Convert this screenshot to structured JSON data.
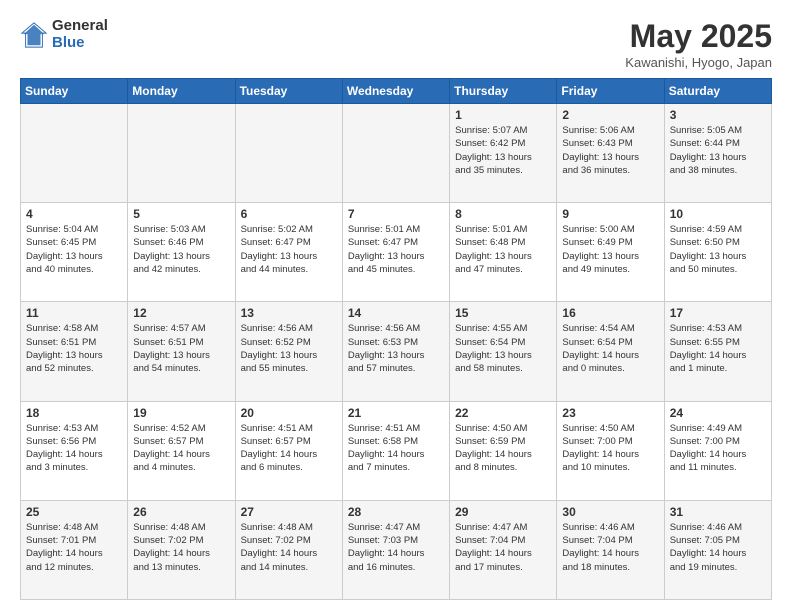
{
  "logo": {
    "general": "General",
    "blue": "Blue"
  },
  "header": {
    "title": "May 2025",
    "subtitle": "Kawanishi, Hyogo, Japan"
  },
  "weekdays": [
    "Sunday",
    "Monday",
    "Tuesday",
    "Wednesday",
    "Thursday",
    "Friday",
    "Saturday"
  ],
  "weeks": [
    [
      {
        "day": "",
        "info": ""
      },
      {
        "day": "",
        "info": ""
      },
      {
        "day": "",
        "info": ""
      },
      {
        "day": "",
        "info": ""
      },
      {
        "day": "1",
        "info": "Sunrise: 5:07 AM\nSunset: 6:42 PM\nDaylight: 13 hours\nand 35 minutes."
      },
      {
        "day": "2",
        "info": "Sunrise: 5:06 AM\nSunset: 6:43 PM\nDaylight: 13 hours\nand 36 minutes."
      },
      {
        "day": "3",
        "info": "Sunrise: 5:05 AM\nSunset: 6:44 PM\nDaylight: 13 hours\nand 38 minutes."
      }
    ],
    [
      {
        "day": "4",
        "info": "Sunrise: 5:04 AM\nSunset: 6:45 PM\nDaylight: 13 hours\nand 40 minutes."
      },
      {
        "day": "5",
        "info": "Sunrise: 5:03 AM\nSunset: 6:46 PM\nDaylight: 13 hours\nand 42 minutes."
      },
      {
        "day": "6",
        "info": "Sunrise: 5:02 AM\nSunset: 6:47 PM\nDaylight: 13 hours\nand 44 minutes."
      },
      {
        "day": "7",
        "info": "Sunrise: 5:01 AM\nSunset: 6:47 PM\nDaylight: 13 hours\nand 45 minutes."
      },
      {
        "day": "8",
        "info": "Sunrise: 5:01 AM\nSunset: 6:48 PM\nDaylight: 13 hours\nand 47 minutes."
      },
      {
        "day": "9",
        "info": "Sunrise: 5:00 AM\nSunset: 6:49 PM\nDaylight: 13 hours\nand 49 minutes."
      },
      {
        "day": "10",
        "info": "Sunrise: 4:59 AM\nSunset: 6:50 PM\nDaylight: 13 hours\nand 50 minutes."
      }
    ],
    [
      {
        "day": "11",
        "info": "Sunrise: 4:58 AM\nSunset: 6:51 PM\nDaylight: 13 hours\nand 52 minutes."
      },
      {
        "day": "12",
        "info": "Sunrise: 4:57 AM\nSunset: 6:51 PM\nDaylight: 13 hours\nand 54 minutes."
      },
      {
        "day": "13",
        "info": "Sunrise: 4:56 AM\nSunset: 6:52 PM\nDaylight: 13 hours\nand 55 minutes."
      },
      {
        "day": "14",
        "info": "Sunrise: 4:56 AM\nSunset: 6:53 PM\nDaylight: 13 hours\nand 57 minutes."
      },
      {
        "day": "15",
        "info": "Sunrise: 4:55 AM\nSunset: 6:54 PM\nDaylight: 13 hours\nand 58 minutes."
      },
      {
        "day": "16",
        "info": "Sunrise: 4:54 AM\nSunset: 6:54 PM\nDaylight: 14 hours\nand 0 minutes."
      },
      {
        "day": "17",
        "info": "Sunrise: 4:53 AM\nSunset: 6:55 PM\nDaylight: 14 hours\nand 1 minute."
      }
    ],
    [
      {
        "day": "18",
        "info": "Sunrise: 4:53 AM\nSunset: 6:56 PM\nDaylight: 14 hours\nand 3 minutes."
      },
      {
        "day": "19",
        "info": "Sunrise: 4:52 AM\nSunset: 6:57 PM\nDaylight: 14 hours\nand 4 minutes."
      },
      {
        "day": "20",
        "info": "Sunrise: 4:51 AM\nSunset: 6:57 PM\nDaylight: 14 hours\nand 6 minutes."
      },
      {
        "day": "21",
        "info": "Sunrise: 4:51 AM\nSunset: 6:58 PM\nDaylight: 14 hours\nand 7 minutes."
      },
      {
        "day": "22",
        "info": "Sunrise: 4:50 AM\nSunset: 6:59 PM\nDaylight: 14 hours\nand 8 minutes."
      },
      {
        "day": "23",
        "info": "Sunrise: 4:50 AM\nSunset: 7:00 PM\nDaylight: 14 hours\nand 10 minutes."
      },
      {
        "day": "24",
        "info": "Sunrise: 4:49 AM\nSunset: 7:00 PM\nDaylight: 14 hours\nand 11 minutes."
      }
    ],
    [
      {
        "day": "25",
        "info": "Sunrise: 4:48 AM\nSunset: 7:01 PM\nDaylight: 14 hours\nand 12 minutes."
      },
      {
        "day": "26",
        "info": "Sunrise: 4:48 AM\nSunset: 7:02 PM\nDaylight: 14 hours\nand 13 minutes."
      },
      {
        "day": "27",
        "info": "Sunrise: 4:48 AM\nSunset: 7:02 PM\nDaylight: 14 hours\nand 14 minutes."
      },
      {
        "day": "28",
        "info": "Sunrise: 4:47 AM\nSunset: 7:03 PM\nDaylight: 14 hours\nand 16 minutes."
      },
      {
        "day": "29",
        "info": "Sunrise: 4:47 AM\nSunset: 7:04 PM\nDaylight: 14 hours\nand 17 minutes."
      },
      {
        "day": "30",
        "info": "Sunrise: 4:46 AM\nSunset: 7:04 PM\nDaylight: 14 hours\nand 18 minutes."
      },
      {
        "day": "31",
        "info": "Sunrise: 4:46 AM\nSunset: 7:05 PM\nDaylight: 14 hours\nand 19 minutes."
      }
    ]
  ]
}
